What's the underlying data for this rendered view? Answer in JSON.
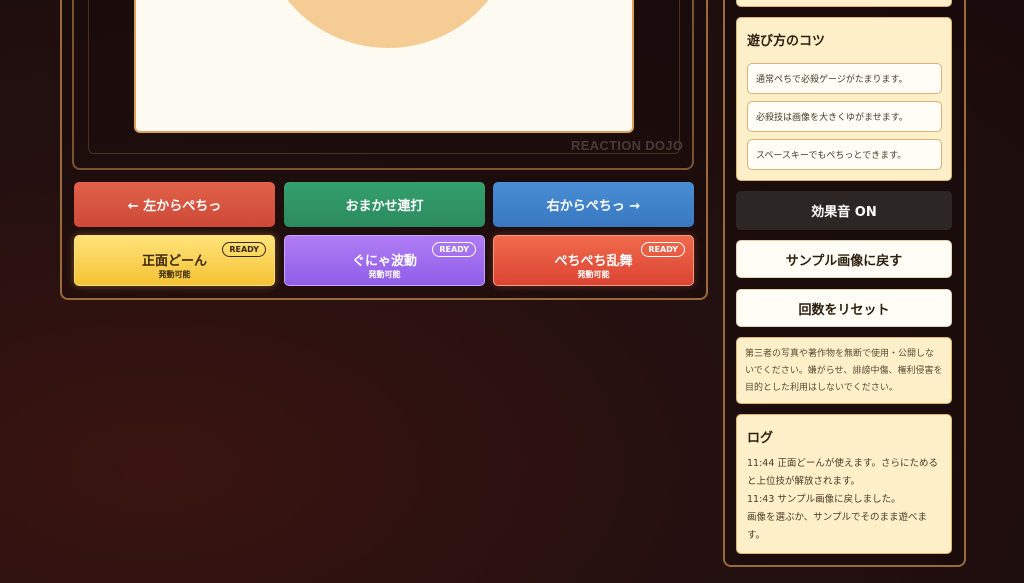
{
  "stage": {
    "watermark": "REACTION DOJO"
  },
  "controls": {
    "left_label": "← 左からぺちっ",
    "random_label": "おまかせ連打",
    "right_label": "右からぺちっ →"
  },
  "skills": [
    {
      "title": "正面どーん",
      "status": "発動可能",
      "badge": "READY",
      "color": "#f5c234"
    },
    {
      "title": "ぐにゃ波動",
      "status": "発動可能",
      "badge": "READY",
      "color": "#8f5ee8"
    },
    {
      "title": "ぺちぺち乱舞",
      "status": "発動可能",
      "badge": "READY",
      "color": "#dc4433"
    }
  ],
  "tips": {
    "heading": "遊び方のコツ",
    "items": [
      "通常ぺちで必殺ゲージがたまります。",
      "必殺技は画像を大きくゆがませます。",
      "スペースキーでもぺちっとできます。"
    ]
  },
  "sidebar": {
    "sound_label": "効果音 ON",
    "sample_label": "サンプル画像に戻す",
    "reset_label": "回数をリセット",
    "notice": "第三者の写真や著作物を無断で使用・公開しないでください。嫌がらせ、誹謗中傷、権利侵害を目的とした利用はしないでください。"
  },
  "log": {
    "heading": "ログ",
    "entries": [
      "11:44 正面どーんが使えます。さらにためると上位技が解放されます。",
      "11:43 サンプル画像に戻しました。",
      "画像を選ぶか、サンプルでそのまま遊べます。"
    ]
  },
  "colors": {
    "accent_border": "#9b6a3a",
    "card_bg": "#fdf0c8",
    "canvas_bg": "#fdfaf1"
  }
}
